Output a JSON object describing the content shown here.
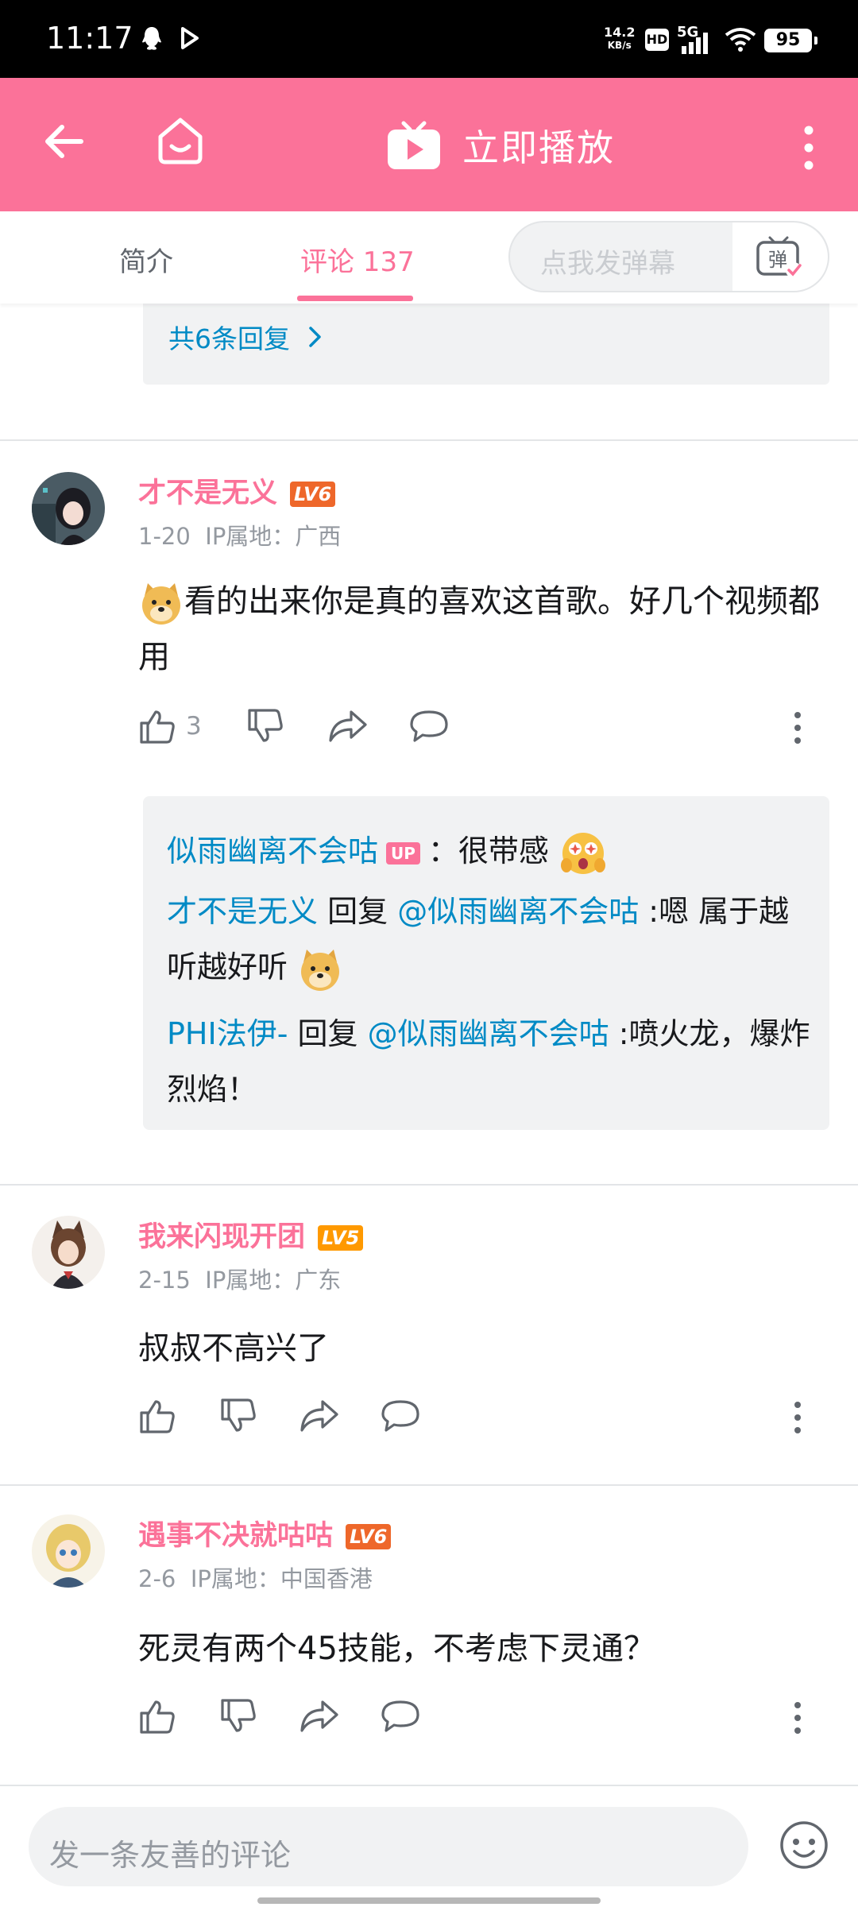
{
  "status_bar": {
    "time": "11:17",
    "net_speed": "14.2",
    "net_unit": "KB/s",
    "hd": "HD",
    "network": "5G",
    "battery": "95"
  },
  "title_bar": {
    "play_label": "立即播放"
  },
  "tabs": {
    "intro": "简介",
    "comments": "评论 137",
    "danmu_placeholder": "点我发弹幕"
  },
  "top_reply_more": "共6条回复",
  "comments": [
    {
      "username": "才不是无义",
      "level": "LV6",
      "date": "1-20",
      "ip": "IP属地：广西",
      "text": "看的出来你是真的喜欢这首歌。好几个视频都用",
      "likes": "3",
      "replies": [
        {
          "user": "似雨幽离不会咕",
          "tag": "UP",
          "text": "：很带感"
        },
        {
          "user": "才不是无义",
          "reply_word": " 回复 ",
          "target": "@似雨幽离不会咕",
          "text": " :嗯 属于越听越好听"
        },
        {
          "user": "PHI法伊-",
          "reply_word": " 回复 ",
          "target": "@似雨幽离不会咕",
          "text": " :喷火龙，爆炸烈焰！"
        }
      ]
    },
    {
      "username": "我来闪现开团",
      "level": "LV5",
      "date": "2-15",
      "ip": "IP属地：广东",
      "text": "叔叔不高兴了"
    },
    {
      "username": "遇事不决就咕咕",
      "level": "LV6",
      "date": "2-6",
      "ip": "IP属地：中国香港",
      "text": "死灵有两个45技能，不考虑下灵通？"
    }
  ],
  "bottom_bar": {
    "placeholder": "发一条友善的评论"
  },
  "colors": {
    "brand_pink": "#fb7299",
    "link_blue": "#008ac5",
    "gray_text": "#9499a0"
  }
}
